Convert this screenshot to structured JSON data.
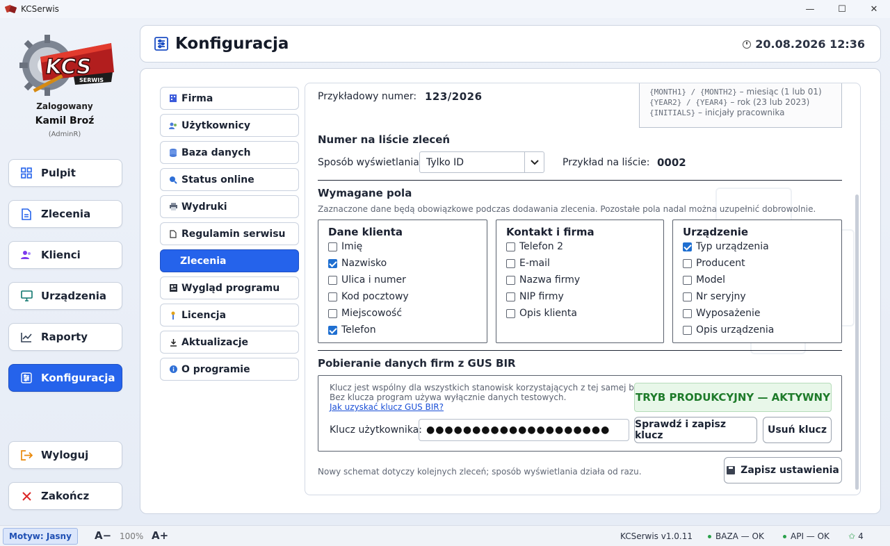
{
  "window": {
    "title": "KCSerwis",
    "minimize": "—",
    "maximize": "☐",
    "close": "✕"
  },
  "user": {
    "logged_label": "Zalogowany",
    "name": "Kamil Broź",
    "role": "(AdminR)"
  },
  "logo": {
    "text": "KCS",
    "sub": "SERWIS"
  },
  "nav": [
    {
      "label": "Pulpit",
      "icon": "grid-icon"
    },
    {
      "label": "Zlecenia",
      "icon": "document-icon"
    },
    {
      "label": "Klienci",
      "icon": "users-icon"
    },
    {
      "label": "Urządzenia",
      "icon": "monitor-icon"
    },
    {
      "label": "Raporty",
      "icon": "chart-icon"
    },
    {
      "label": "Konfiguracja",
      "icon": "sliders-icon",
      "active": true
    },
    {
      "label": "Wyloguj",
      "icon": "logout-icon"
    },
    {
      "label": "Zakończ",
      "icon": "close-icon"
    }
  ],
  "header": {
    "title": "Konfiguracja",
    "datetime": "20.08.2026 12:36"
  },
  "submenu": [
    {
      "label": "Firma"
    },
    {
      "label": "Użytkownicy"
    },
    {
      "label": "Baza danych"
    },
    {
      "label": "Status online"
    },
    {
      "label": "Wydruki"
    },
    {
      "label": "Regulamin serwisu"
    },
    {
      "label": "Zlecenia",
      "active": true
    },
    {
      "label": "Wygląd programu"
    },
    {
      "label": "Licencja"
    },
    {
      "label": "Aktualizacje"
    },
    {
      "label": "O programie"
    }
  ],
  "content": {
    "example_label": "Przykładowy numer:",
    "example_value": "123/2026",
    "hint_lines": [
      {
        "code": "{MONTH1} / {MONTH2}",
        "desc": " – miesiąc (1 lub 01)"
      },
      {
        "code": "{YEAR2} / {YEAR4}",
        "desc": " – rok (23 lub 2023)"
      },
      {
        "code": "{INITIALS}",
        "desc": " – inicjały pracownika"
      }
    ],
    "list_section_title": "Numer na liście zleceń",
    "display_mode_label": "Sposób wyświetlania:",
    "display_mode_value": "Tylko ID",
    "list_example_label": "Przykład na liście:",
    "list_example_value": "0002",
    "required_title": "Wymagane pola",
    "required_desc": "Zaznaczone dane będą obowiązkowe podczas dodawania zlecenia. Pozostałe pola nadal można uzupełnić dobrowolnie.",
    "groups": [
      {
        "title": "Dane klienta",
        "items": [
          {
            "label": "Imię",
            "checked": false
          },
          {
            "label": "Nazwisko",
            "checked": true
          },
          {
            "label": "Ulica i numer",
            "checked": false
          },
          {
            "label": "Kod pocztowy",
            "checked": false
          },
          {
            "label": "Miejscowość",
            "checked": false
          },
          {
            "label": "Telefon",
            "checked": true
          }
        ]
      },
      {
        "title": "Kontakt i firma",
        "items": [
          {
            "label": "Telefon 2",
            "checked": false
          },
          {
            "label": "E-mail",
            "checked": false
          },
          {
            "label": "Nazwa firmy",
            "checked": false
          },
          {
            "label": "NIP firmy",
            "checked": false
          },
          {
            "label": "Opis klienta",
            "checked": false
          }
        ]
      },
      {
        "title": "Urządzenie",
        "items": [
          {
            "label": "Typ urządzenia",
            "checked": true
          },
          {
            "label": "Producent",
            "checked": false
          },
          {
            "label": "Model",
            "checked": false
          },
          {
            "label": "Nr seryjny",
            "checked": false
          },
          {
            "label": "Wyposażenie",
            "checked": false
          },
          {
            "label": "Opis urządzenia",
            "checked": false
          }
        ]
      }
    ],
    "gus_title": "Pobieranie danych firm z GUS BIR",
    "gus_desc1": "Klucz jest wspólny dla wszystkich stanowisk korzystających z tej samej bazy.",
    "gus_desc2": "Bez klucza program używa wyłącznie danych testowych.",
    "gus_link": "Jak uzyskać klucz GUS BIR?",
    "gus_status": "TRYB PRODUKCYJNY — AKTYWNY",
    "key_label": "Klucz użytkownika:",
    "key_value": "●●●●●●●●●●●●●●●●●●●●",
    "check_save_label": "Sprawdź i zapisz klucz",
    "remove_key_label": "Usuń klucz",
    "footer_note": "Nowy schemat dotyczy kolejnych zleceń; sposób wyświetlania działa od razu.",
    "save_label": "Zapisz ustawienia"
  },
  "statusbar": {
    "theme": "Motyw: Jasny",
    "font_minus": "A−",
    "zoom": "100%",
    "font_plus": "A+",
    "version": "KCSerwis v1.0.11",
    "db_status": "BAZA — OK",
    "api_status": "API — OK",
    "users_count": "4"
  }
}
